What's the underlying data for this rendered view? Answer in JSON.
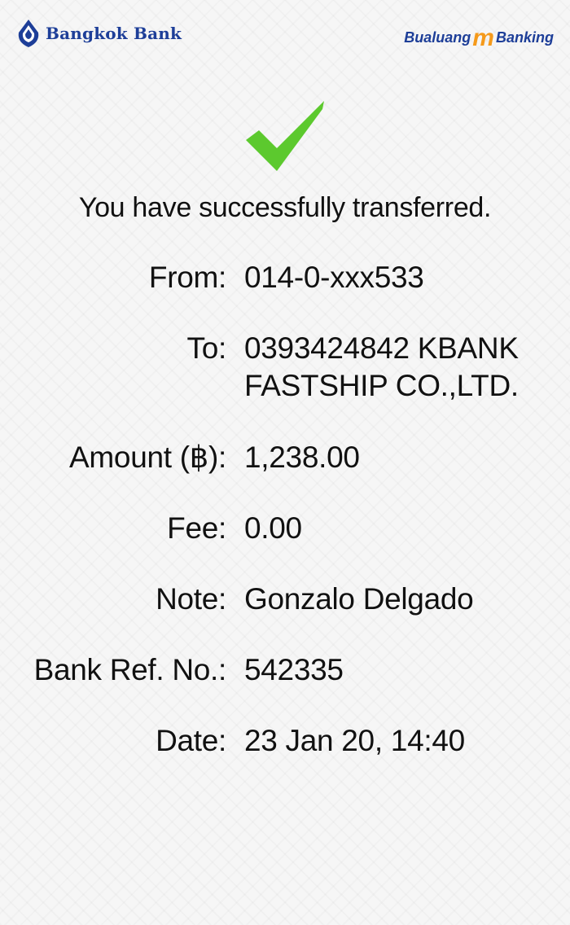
{
  "header": {
    "bank_name": "Bangkok Bank",
    "app_brand": {
      "left": "Bualuang",
      "mid": "m",
      "right": "Banking"
    }
  },
  "status": {
    "icon": "success-check-icon",
    "message": "You have successfully transferred."
  },
  "details": {
    "from": {
      "label": "From:",
      "value": "014-0-xxx533"
    },
    "to": {
      "label": "To:",
      "value_line1": "0393424842 KBANK",
      "value_line2": "FASTSHIP CO.,LTD."
    },
    "amount": {
      "label": "Amount (฿):",
      "value": "1,238.00"
    },
    "fee": {
      "label": "Fee:",
      "value": "0.00"
    },
    "note": {
      "label": "Note:",
      "value": "Gonzalo Delgado"
    },
    "bank_ref": {
      "label": "Bank Ref. No.:",
      "value": "542335"
    },
    "date": {
      "label": "Date:",
      "value": "23 Jan 20, 14:40"
    }
  },
  "colors": {
    "brand_blue": "#1d3e98",
    "brand_orange": "#f59a1b",
    "success_green": "#5cc92e"
  }
}
